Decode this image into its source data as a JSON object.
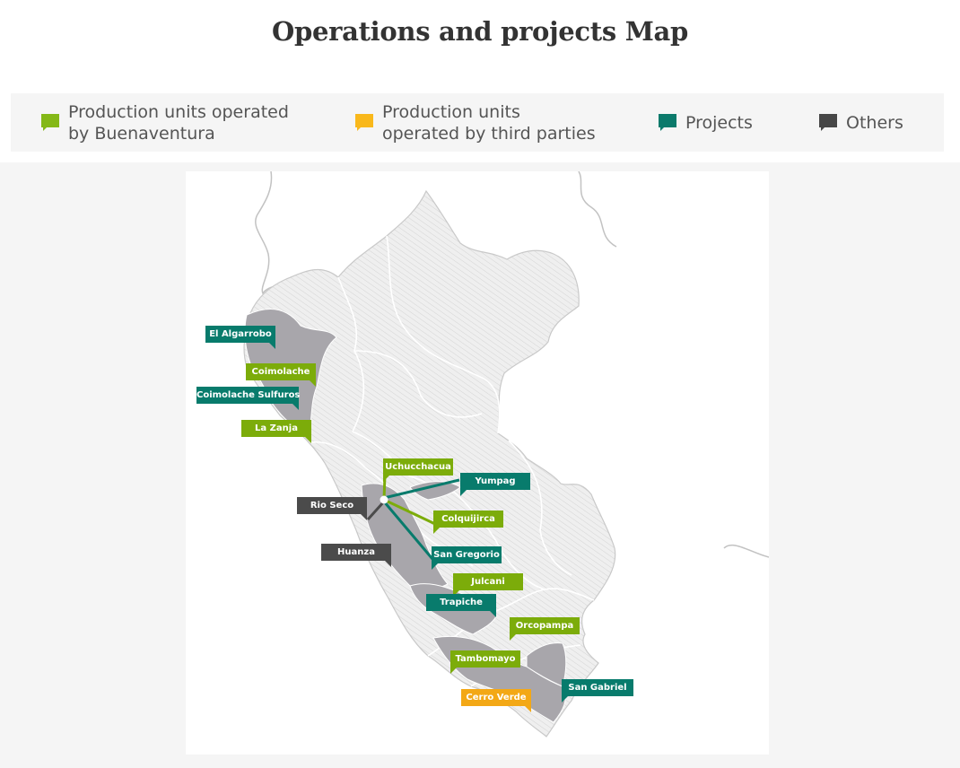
{
  "title": "Operations and projects Map",
  "legend": [
    {
      "line1": "Production units operated",
      "line2": "by Buenaventura",
      "color": "#84b817",
      "icon": "green-flag-icon"
    },
    {
      "line1": "Production units",
      "line2": "operated by third parties",
      "color": "#f9b81b",
      "icon": "yellow-flag-icon"
    },
    {
      "line1": "Projects",
      "line2": "",
      "color": "#0b7a6b",
      "icon": "teal-flag-icon"
    },
    {
      "line1": "Others",
      "line2": "",
      "color": "#474747",
      "icon": "gray-flag-icon"
    }
  ],
  "colors": {
    "buenaventura": "#7cac0a",
    "third_party": "#f3a816",
    "project": "#087b6c",
    "other": "#4b4b4b",
    "region_highlight": "#a8a6ab",
    "region_fill": "#ececec",
    "border": "#c9c9c9"
  },
  "locations": [
    {
      "name": "El Algarrobo",
      "category": "project"
    },
    {
      "name": "Coimolache",
      "category": "buenaventura"
    },
    {
      "name": "Coimolache Sulfuros",
      "category": "project"
    },
    {
      "name": "La Zanja",
      "category": "buenaventura"
    },
    {
      "name": "Uchucchacua",
      "category": "buenaventura"
    },
    {
      "name": "Yumpag",
      "category": "project"
    },
    {
      "name": "Rio Seco",
      "category": "other"
    },
    {
      "name": "Colquijirca",
      "category": "buenaventura"
    },
    {
      "name": "Huanza",
      "category": "other"
    },
    {
      "name": "San Gregorio",
      "category": "project"
    },
    {
      "name": "Julcani",
      "category": "buenaventura"
    },
    {
      "name": "Trapiche",
      "category": "project"
    },
    {
      "name": "Orcopampa",
      "category": "buenaventura"
    },
    {
      "name": "Tambomayo",
      "category": "buenaventura"
    },
    {
      "name": "San Gabriel",
      "category": "project"
    },
    {
      "name": "Cerro Verde",
      "category": "third_party"
    }
  ]
}
